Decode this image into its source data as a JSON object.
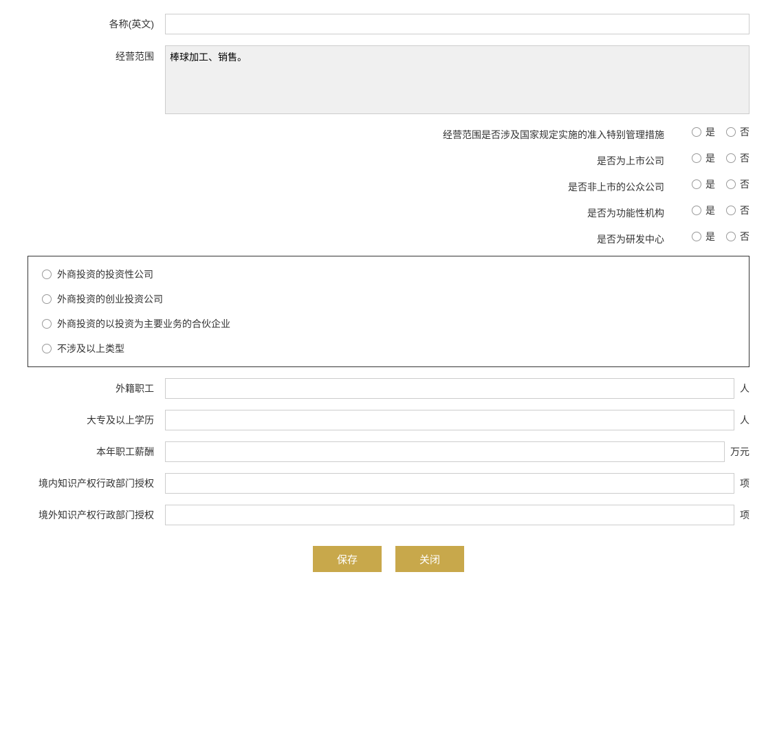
{
  "form": {
    "name_en_label": "各称(英文)",
    "name_en_value": "",
    "business_scope_label": "经营范围",
    "business_scope_value": "棒球加工、销售。",
    "special_mgmt_label": "经营范围是否涉及国家规定实施的准入特别管理措施",
    "yes_label": "是",
    "no_label": "否",
    "listed_company_label": "是否为上市公司",
    "non_listed_public_label": "是否非上市的公众公司",
    "functional_org_label": "是否为功能性机构",
    "rd_center_label": "是否为研发中心",
    "investment_company_label": "外商投资的投资性公司",
    "venture_company_label": "外商投资的创业投资公司",
    "partnership_label": "外商投资的以投资为主要业务的合伙企业",
    "not_applicable_label": "不涉及以上类型",
    "foreign_staff_label": "外籍职工",
    "foreign_staff_value": "",
    "foreign_staff_unit": "人",
    "college_above_label": "大专及以上学历",
    "college_above_value": "",
    "college_above_unit": "人",
    "annual_salary_label": "本年职工薪酬",
    "annual_salary_value": "",
    "annual_salary_unit": "万元",
    "domestic_ip_label": "境内知识产权行政部门授权",
    "domestic_ip_value": "",
    "domestic_ip_unit": "项",
    "overseas_ip_label": "境外知识产权行政部门授权",
    "overseas_ip_value": "",
    "overseas_ip_unit": "项",
    "save_button": "保存",
    "close_button": "关闭"
  }
}
